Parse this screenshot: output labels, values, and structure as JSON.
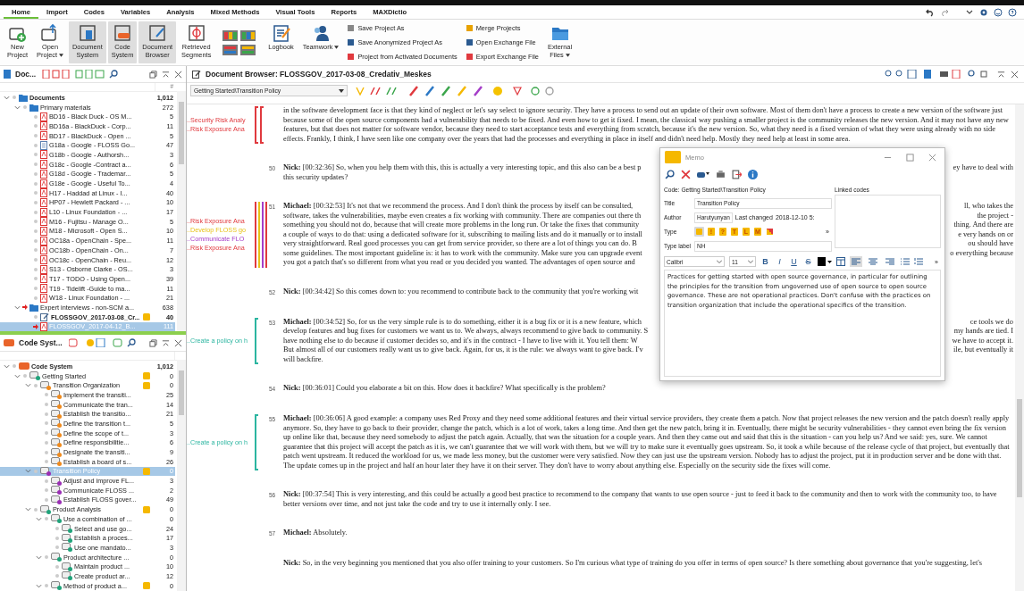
{
  "ribbon_tabs": [
    {
      "label": "Home",
      "selected": true
    },
    {
      "label": "Import",
      "selected": false
    },
    {
      "label": "Codes",
      "selected": false
    },
    {
      "label": "Variables",
      "selected": false
    },
    {
      "label": "Analysis",
      "selected": false
    },
    {
      "label": "Mixed Methods",
      "selected": false
    },
    {
      "label": "Visual Tools",
      "selected": false
    },
    {
      "label": "Reports",
      "selected": false
    },
    {
      "label": "MAXDictio",
      "selected": false
    }
  ],
  "ribbon_buttons": [
    {
      "lines": [
        "New",
        "Project"
      ],
      "dropdown": false,
      "pressed": false
    },
    {
      "lines": [
        "Open",
        "Project"
      ],
      "dropdown": true,
      "pressed": false
    },
    {
      "lines": [
        "Document",
        "System"
      ],
      "dropdown": false,
      "pressed": true
    },
    {
      "lines": [
        "Code",
        "System"
      ],
      "dropdown": false,
      "pressed": true
    },
    {
      "lines": [
        "Document",
        "Browser"
      ],
      "dropdown": false,
      "pressed": true
    },
    {
      "lines": [
        "Retrieved",
        "Segments"
      ],
      "dropdown": false,
      "pressed": false
    }
  ],
  "ribbon_buttons_2": [
    {
      "lines": [
        "Logbook"
      ],
      "dropdown": false,
      "pressed": false
    },
    {
      "lines": [
        "Teamwork"
      ],
      "dropdown": true,
      "pressed": false
    }
  ],
  "small_buttons": [
    {
      "label": "Save Project As"
    },
    {
      "label": "Save Anonymized Project As"
    },
    {
      "label": "Project from Activated Documents"
    },
    {
      "label": "Merge Projects"
    },
    {
      "label": "Open Exchange File"
    },
    {
      "label": "Export Exchange File"
    }
  ],
  "ribbon_buttons_3": [
    {
      "lines": [
        "External",
        "Files"
      ],
      "dropdown": true,
      "pressed": false
    }
  ],
  "document_panel": {
    "title": "Doc...",
    "count_header": "#",
    "root": {
      "name": "Documents",
      "count": "1,012",
      "expanded": true,
      "children": [
        {
          "name": "Primary materials",
          "count": "272",
          "kind": "folder",
          "activated": false,
          "memo": false,
          "selected": false,
          "expanded": true,
          "children": [
            {
              "name": "BD16 - Black Duck - OS M...",
              "count": "5",
              "kind": "pdf",
              "activated": false,
              "memo": false,
              "selected": false
            },
            {
              "name": "BD16a - BlackDuck - Corp...",
              "count": "11",
              "kind": "pdf",
              "activated": false,
              "memo": false,
              "selected": false
            },
            {
              "name": "BD17 - BlackDuck - Open ...",
              "count": "5",
              "kind": "pdf",
              "activated": false,
              "memo": false,
              "selected": false
            },
            {
              "name": "G18a - Google - FLOSS Go...",
              "count": "47",
              "kind": "text",
              "activated": false,
              "memo": false,
              "selected": false
            },
            {
              "name": "G18b - Google - Authorsh...",
              "count": "3",
              "kind": "pdf",
              "activated": false,
              "memo": false,
              "selected": false
            },
            {
              "name": "G18c - Google -Contract a...",
              "count": "6",
              "kind": "pdf",
              "activated": false,
              "memo": false,
              "selected": false
            },
            {
              "name": "G18d - Google - Trademar...",
              "count": "5",
              "kind": "pdf",
              "activated": false,
              "memo": false,
              "selected": false
            },
            {
              "name": "G18e - Google - Useful To...",
              "count": "4",
              "kind": "pdf",
              "activated": false,
              "memo": false,
              "selected": false
            },
            {
              "name": "H17 - Haddad at Linux - I...",
              "count": "40",
              "kind": "pdf",
              "activated": false,
              "memo": false,
              "selected": false
            },
            {
              "name": "HP07 - Hewlett Packard - ...",
              "count": "10",
              "kind": "pdf",
              "activated": false,
              "memo": false,
              "selected": false
            },
            {
              "name": "L10 - Linux Foundation - ...",
              "count": "17",
              "kind": "pdf",
              "activated": false,
              "memo": false,
              "selected": false
            },
            {
              "name": "M16 - Fujitsu - Manage O...",
              "count": "5",
              "kind": "pdf",
              "activated": false,
              "memo": false,
              "selected": false
            },
            {
              "name": "M18 - Microsoft - Open S...",
              "count": "10",
              "kind": "pdf",
              "activated": false,
              "memo": false,
              "selected": false
            },
            {
              "name": "OC18a - OpenChain - Spe...",
              "count": "11",
              "kind": "pdf",
              "activated": false,
              "memo": false,
              "selected": false
            },
            {
              "name": "OC18b - OpenChain - On...",
              "count": "7",
              "kind": "pdf",
              "activated": false,
              "memo": false,
              "selected": false
            },
            {
              "name": "OC18c - OpenChain - Reu...",
              "count": "12",
              "kind": "pdf",
              "activated": false,
              "memo": false,
              "selected": false
            },
            {
              "name": "S13 - Osborne Clarke - OS...",
              "count": "3",
              "kind": "pdf",
              "activated": false,
              "memo": false,
              "selected": false
            },
            {
              "name": "T17 - TODO - Using Open...",
              "count": "39",
              "kind": "pdf",
              "activated": false,
              "memo": false,
              "selected": false
            },
            {
              "name": "T19 - Tidelift -Guide to ma...",
              "count": "11",
              "kind": "pdf",
              "activated": false,
              "memo": false,
              "selected": false
            },
            {
              "name": "W18 - Linux Foundation - ...",
              "count": "21",
              "kind": "pdf",
              "activated": false,
              "memo": false,
              "selected": false
            }
          ]
        },
        {
          "name": "Expert interviews - non-SCM a...",
          "count": "638",
          "kind": "folder",
          "activated": true,
          "memo": false,
          "selected": false,
          "expanded": true,
          "children": [
            {
              "name": "FLOSSGOV_2017-03-08_Cr...",
              "count": "40",
              "kind": "open-document",
              "activated": false,
              "memo": true,
              "selected": false
            },
            {
              "name": "FLOSSGOV_2017-04-12_B...",
              "count": "111",
              "kind": "pdf",
              "activated": true,
              "memo": false,
              "selected": true
            }
          ]
        }
      ]
    }
  },
  "code_panel": {
    "title": "Code Syst...",
    "root": {
      "name": "Code System",
      "count": "1,012",
      "expanded": true,
      "children": [
        {
          "name": "Getting Started",
          "count": "0",
          "color": "#1fa37a",
          "memo": true,
          "selected": false,
          "expanded": true,
          "children": [
            {
              "name": "Transition Organization",
              "count": "0",
              "color": "#f08a1c",
              "memo": true,
              "selected": false,
              "expanded": true,
              "children": [
                {
                  "name": "Implement the transiti...",
                  "count": "25",
                  "color": "#f08a1c",
                  "memo": false,
                  "selected": false
                },
                {
                  "name": "Communicate the tran...",
                  "count": "14",
                  "color": "#f08a1c",
                  "memo": false,
                  "selected": false
                },
                {
                  "name": "Establish the transitio...",
                  "count": "21",
                  "color": "#f08a1c",
                  "memo": false,
                  "selected": false
                },
                {
                  "name": "Define the transition t...",
                  "count": "5",
                  "color": "#f08a1c",
                  "memo": false,
                  "selected": false
                },
                {
                  "name": "Define the scope of t...",
                  "count": "3",
                  "color": "#f08a1c",
                  "memo": false,
                  "selected": false
                },
                {
                  "name": "Define responsibilitie...",
                  "count": "6",
                  "color": "#f08a1c",
                  "memo": false,
                  "selected": false
                },
                {
                  "name": "Designate the transiti...",
                  "count": "9",
                  "color": "#f08a1c",
                  "memo": false,
                  "selected": false
                },
                {
                  "name": "Establish a board of s...",
                  "count": "26",
                  "color": "#f08a1c",
                  "memo": false,
                  "selected": false
                }
              ]
            },
            {
              "name": "Transition Policy",
              "count": "0",
              "color": "#9b2fb5",
              "memo": true,
              "selected": true,
              "expanded": true,
              "children": [
                {
                  "name": "Adjust and improve FL...",
                  "count": "3",
                  "color": "#9b2fb5",
                  "memo": false,
                  "selected": false
                },
                {
                  "name": "Communicate FLOSS ...",
                  "count": "2",
                  "color": "#9b2fb5",
                  "memo": false,
                  "selected": false
                },
                {
                  "name": "Establish FLOSS gover...",
                  "count": "49",
                  "color": "#9b2fb5",
                  "memo": false,
                  "selected": false
                }
              ]
            },
            {
              "name": "Product Analysis",
              "count": "0",
              "color": "#1fa37a",
              "memo": true,
              "selected": false,
              "expanded": true,
              "children": [
                {
                  "name": "Use a combination of ...",
                  "count": "0",
                  "color": "#1fa37a",
                  "memo": false,
                  "selected": false,
                  "expanded": true,
                  "children": [
                    {
                      "name": "Select and use go...",
                      "count": "24",
                      "color": "#1fa37a",
                      "memo": false,
                      "selected": false
                    },
                    {
                      "name": "Establish a proces...",
                      "count": "17",
                      "color": "#1fa37a",
                      "memo": false,
                      "selected": false
                    },
                    {
                      "name": "Use one mandato...",
                      "count": "3",
                      "color": "#1fa37a",
                      "memo": false,
                      "selected": false
                    }
                  ]
                },
                {
                  "name": "Product architecture ...",
                  "count": "0",
                  "color": "#1fa37a",
                  "memo": false,
                  "selected": false,
                  "expanded": true,
                  "children": [
                    {
                      "name": "Maintain product ...",
                      "count": "10",
                      "color": "#1fa37a",
                      "memo": false,
                      "selected": false
                    },
                    {
                      "name": "Create product ar...",
                      "count": "12",
                      "color": "#1fa37a",
                      "memo": false,
                      "selected": false
                    }
                  ]
                },
                {
                  "name": "Method of product a...",
                  "count": "0",
                  "color": "#1fa37a",
                  "memo": true,
                  "selected": false,
                  "expanded": true
                }
              ]
            }
          ]
        }
      ]
    }
  },
  "browser": {
    "title": "Document Browser: FLOSSGOV_2017-03-08_Credativ_Meskes",
    "code_filter": "Getting Started\\Transition Policy",
    "paragraphs": [
      {
        "codings": [
          {
            "label": "..Security Risk Analy",
            "color": "#e0393e"
          },
          {
            "label": "..Risk Exposure Ana",
            "color": "#e0393e"
          }
        ],
        "text": "in the software development face is that they kind of neglect or let's say select to ignore security. They have a process to send out an update of their own software. Most of them don't have a process to create a new version of the software just because some of the open source components had a vulnerability that needs to be fixed. And even how to get it fixed. I mean, the classical way pushing a smaller project is the community releases the new version. And it may not have any new features, but that does not matter for software vendor, because they need to start acceptance tests and everything from scratch, because it's the new version. So, what they need is a fixed version of what they were using already with no side effects. Frankly, I think, I have seen like one company over the years that had the processes and everything in place in itself and didn't need help. Mostly they need help at least in some area."
      },
      {
        "number": "50",
        "lines": [
          {
            "left": "**Nick:** [00:32:36] So, when you help them with this, this is actually a very interesting topic, and this also can be a best p",
            "right": "ey have to deal with"
          },
          {
            "left": "this security updates?"
          }
        ]
      },
      {
        "number": "51",
        "codings": [
          {
            "label": "..Risk Exposure Ana",
            "color": "#e0393e"
          },
          {
            "label": "..Develop FLOSS go",
            "color": "#e8c21a"
          },
          {
            "label": "..Communicate FLO",
            "color": "#a43cc8"
          },
          {
            "label": "..Risk Exposure Ana",
            "color": "#e0393e"
          }
        ],
        "lines": [
          {
            "left": "**Michael:** [00:32:53] It's not that we recommend the process. And I don't think the process by itself can be consulted,",
            "right": "ll, who takes the"
          },
          {
            "left": "software, takes the vulnerabilities, maybe even creates a fix working with community. There are companies out there th",
            "right": "the project -"
          },
          {
            "left": "something you should not do, because that will create more problems in the long run. Or take the fixes that community",
            "right": "thing. And there are"
          },
          {
            "left": "a couple of ways to do that: using a dedicated software for it, subscribing to mailing lists and do it manually or to install",
            "right": "e very hands on or"
          },
          {
            "left": "very straightforward. Real good processes you can get from service provider, so there are a lot of things you can do. B",
            "right": "ou should have"
          },
          {
            "left": "some guidelines. The most important guideline is: it has to work with the community. Make sure you can upgrade event",
            "right": "o everything because"
          },
          {
            "left": "you got a patch that's so different from what you read or you decided you wanted. The advantages of open source and"
          }
        ]
      },
      {
        "number": "52",
        "lines": [
          {
            "left": "**Nick:** [00:34:42] So this comes down to: you recommend to contribute back to the community that you're working wit"
          }
        ]
      },
      {
        "number": "53",
        "codings": [
          {
            "label": "..Create a policy on h",
            "color": "#2bb5a0"
          }
        ],
        "lines": [
          {
            "left": "**Michael:** [00:34:52] So, for us the very simple rule is to do something, either it is a bug fix or it is a new feature, which",
            "right": "ce tools we do"
          },
          {
            "left": "develop features and bug fixes for customers we want us to. We always, always recommend to give back to community. S",
            "right": "my hands are tied. I"
          },
          {
            "left": "have nothing else to do because if customer decides so, and it's in the contract - I have to live with it. You tell them: W",
            "right": "we have to accept it."
          },
          {
            "left": "But almost all of our customers really want us to give back. Again, for us, it is the rule: we always want to give back. I'v",
            "right": "ile, but eventually it"
          },
          {
            "left": "will backfire."
          }
        ]
      },
      {
        "number": "54",
        "text": "**Nick:** [00:36:01] Could you elaborate a bit on this. How does it backfire? What specifically is the problem?"
      },
      {
        "number": "55",
        "codings": [
          {
            "label": "..Create a policy on h",
            "color": "#2bb5a0"
          }
        ],
        "text": "**Michael:** [00:36:06] A good example: a company uses Red Proxy and they need some additional features and their virtual service providers, they create them a patch. Now that project releases the new version and the patch doesn't really apply anymore. So, they have to go back to their provider, change the patch, which is a lot of work, takes a long time. And then get the new patch, bring it in. Eventually, there might be security vulnerabilities - they cannot even bring the fix version up online like that, because they need somebody to adjust the patch again. Actually, that was the situation for a couple years. And then they came out and said that this is the situation - can you help us? And we said: yes, sure. We cannot guarantee that this project will accept the patch as it is, we can't guarantee that we will work with them, but we will try to make sure it eventually goes upstream. So, it took a while because of the release cycle of that project, but eventually that patch went upstream. It reduced the workload for us, we made less money, but the customer were very satisfied. Now they can just use the upstream version. Nobody has to adjust the project, put it in production server and be done with that. The update comes up in the project and half an hour later they have it on their server. They don't have to worry about anything else. Especially on the security side the fixes will come."
      },
      {
        "number": "56",
        "text": "**Nick:** [00:37:54] This is very interesting, and this could be actually a good best practice to recommend to the company that wants to use open source - just to feed it back to the community and then to work with the community too, to have better versions over time, and not just take the code and try to use it internally only. I see."
      },
      {
        "number": "57",
        "text": "**Michael:** Absolutely."
      },
      {
        "text": "**Nick:** So, in the very beginning you mentioned that you also offer training to your customers. So I'm curious what type of training do you offer in terms of open source? Is there something about governance that you're suggesting, let's"
      }
    ]
  },
  "memo": {
    "title": "Memo",
    "code_path": "Code: Getting Started\\Transition Policy",
    "linked_codes_label": "Linked codes",
    "title_label": "Title",
    "title_value": "Transition Policy",
    "author_label": "Author",
    "author_value": "Harutyunyan",
    "last_changed_label": "Last changed",
    "last_changed_value": "2018-12-10 5:",
    "type_label": "Type",
    "types": [
      {
        "selected": true
      },
      {
        "glyph": "!",
        "selected": false
      },
      {
        "glyph": "?",
        "selected": false
      },
      {
        "glyph": "T",
        "selected": false
      },
      {
        "glyph": "L",
        "selected": false
      },
      {
        "glyph": "M",
        "selected": false
      },
      {
        "selected": false
      }
    ],
    "more_types": "»",
    "type_label_label": "Type label",
    "type_label_value": "NH",
    "font": "Calibri",
    "font_size": "11",
    "format_buttons": [
      "B",
      "I",
      "U",
      "S"
    ],
    "alignments": [
      {
        "selected": true
      },
      {
        "selected": false
      },
      {
        "selected": false
      }
    ],
    "more_tools": "»",
    "body": "Practices for getting started with open source governance, in particular for outlining the principles for the transition from ungoverned use of open source to open source governance. These are not operational practices. Don't confuse with the practices on transition organization that include the operational specifics of the transition."
  }
}
